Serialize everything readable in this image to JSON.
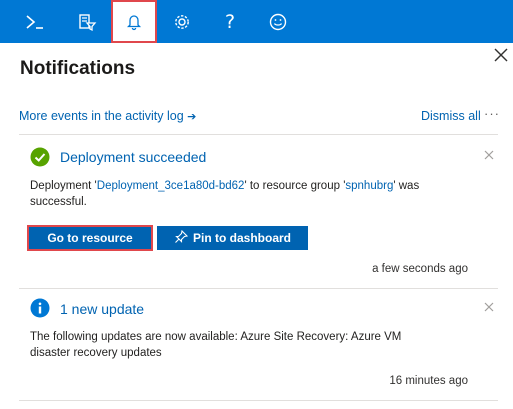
{
  "topbar": {
    "buttons": [
      {
        "name": "cloud-shell",
        "icon": "terminal-icon"
      },
      {
        "name": "directory-filter",
        "icon": "directory-filter-icon"
      },
      {
        "name": "notifications",
        "icon": "bell-icon",
        "active": true
      },
      {
        "name": "settings",
        "icon": "gear-icon"
      },
      {
        "name": "help",
        "icon": "question-icon",
        "glyph": "?"
      },
      {
        "name": "feedback",
        "icon": "smiley-icon"
      }
    ]
  },
  "panel": {
    "title": "Notifications",
    "activity_link": "More events in the activity log",
    "activity_arrow": "➔",
    "dismiss_all": "Dismiss all",
    "more": "···"
  },
  "notifications": [
    {
      "status": "success",
      "title": "Deployment succeeded",
      "body_prefix": "Deployment '",
      "deployment_name": "Deployment_3ce1a80d-bd62",
      "body_middle": "' to resource group '",
      "resource_group": "spnhubrg",
      "body_suffix": "' was successful.",
      "primary_action": "Go to resource",
      "secondary_action": "Pin to dashboard",
      "time": "a few seconds ago"
    },
    {
      "status": "info",
      "title": "1 new update",
      "body_line1": "The following updates are now available: Azure Site Recovery: Azure VM",
      "body_line2": "disaster recovery updates",
      "time": "16 minutes ago"
    }
  ],
  "colors": {
    "topbar": "#0078d4",
    "link": "#0063b1",
    "button": "#0063b1",
    "success": "#57a300",
    "info": "#0078d4",
    "highlight": "#e0474c"
  }
}
